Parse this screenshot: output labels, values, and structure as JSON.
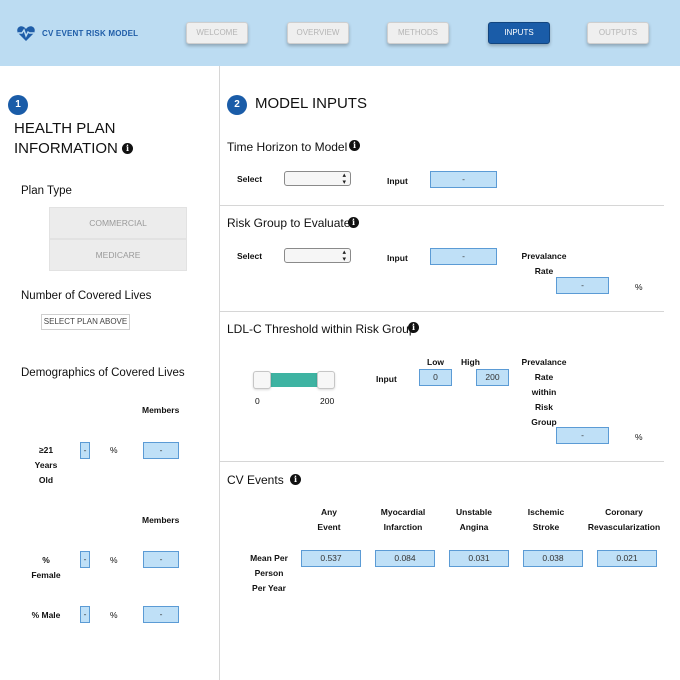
{
  "header": {
    "app_title": "CV EVENT RISK MODEL",
    "nav": [
      {
        "label": "WELCOME",
        "active": false
      },
      {
        "label": "OVERVIEW",
        "active": false
      },
      {
        "label": "METHODS",
        "active": false
      },
      {
        "label": "INPUTS",
        "active": true
      },
      {
        "label": "OUTPUTS",
        "active": false
      }
    ]
  },
  "colors": {
    "accent": "#1a5ca8",
    "header_bg": "#bcdcf2",
    "input_bg": "#bfe0f7",
    "slider": "#3eb3a2"
  },
  "left": {
    "step": "1",
    "title_line1": "HEALTH PLAN",
    "title_line2": "INFORMATION",
    "plan_type_label": "Plan Type",
    "plan_options": [
      "COMMERCIAL",
      "MEDICARE"
    ],
    "covered_lives_label": "Number of Covered Lives",
    "covered_lives_value": "SELECT PLAN ABOVE",
    "demographics_label": "Demographics of Covered Lives",
    "members_header": "Members",
    "age_label": [
      "≥21",
      "Years",
      "Old"
    ],
    "age_pct": "-",
    "age_members": "-",
    "members_header2": "Members",
    "female_label": [
      "%",
      "Female"
    ],
    "female_pct": "-",
    "female_members": "-",
    "male_label": "% Male",
    "male_pct": "-",
    "male_members": "-",
    "pct_symbol": "%"
  },
  "right": {
    "step": "2",
    "title": "MODEL INPUTS",
    "time_horizon": {
      "title": "Time Horizon to Model",
      "select_label": "Select",
      "input_label": "Input",
      "input_value": "-"
    },
    "risk_group": {
      "title": "Risk Group to Evaluate",
      "select_label": "Select",
      "input_label": "Input",
      "input_value": "-",
      "prevalence_label": [
        "Prevalance",
        "Rate"
      ],
      "prevalence_value": "-",
      "pct": "%"
    },
    "ldl": {
      "title": "LDL-C Threshold within Risk Group",
      "slider_min_label": "0",
      "slider_max_label": "200",
      "slider_low": 0,
      "slider_high": 200,
      "input_label": "Input",
      "low_label": "Low",
      "high_label": "High",
      "low_value": "0",
      "high_value": "200",
      "prevalence_label": [
        "Prevalance",
        "Rate",
        "within",
        "Risk",
        "Group"
      ],
      "prevalence_value": "-",
      "pct": "%"
    },
    "cv_events": {
      "title": "CV Events",
      "row_label": [
        "Mean Per",
        "Person",
        "Per Year"
      ],
      "columns": [
        {
          "header": [
            "Any",
            "Event"
          ],
          "value": "0.537"
        },
        {
          "header": [
            "Myocardial",
            "Infarction"
          ],
          "value": "0.084"
        },
        {
          "header": [
            "Unstable",
            "Angina"
          ],
          "value": "0.031"
        },
        {
          "header": [
            "Ischemic",
            "Stroke"
          ],
          "value": "0.038"
        },
        {
          "header": [
            "Coronary",
            "Revascularization"
          ],
          "value": "0.021"
        }
      ]
    }
  }
}
